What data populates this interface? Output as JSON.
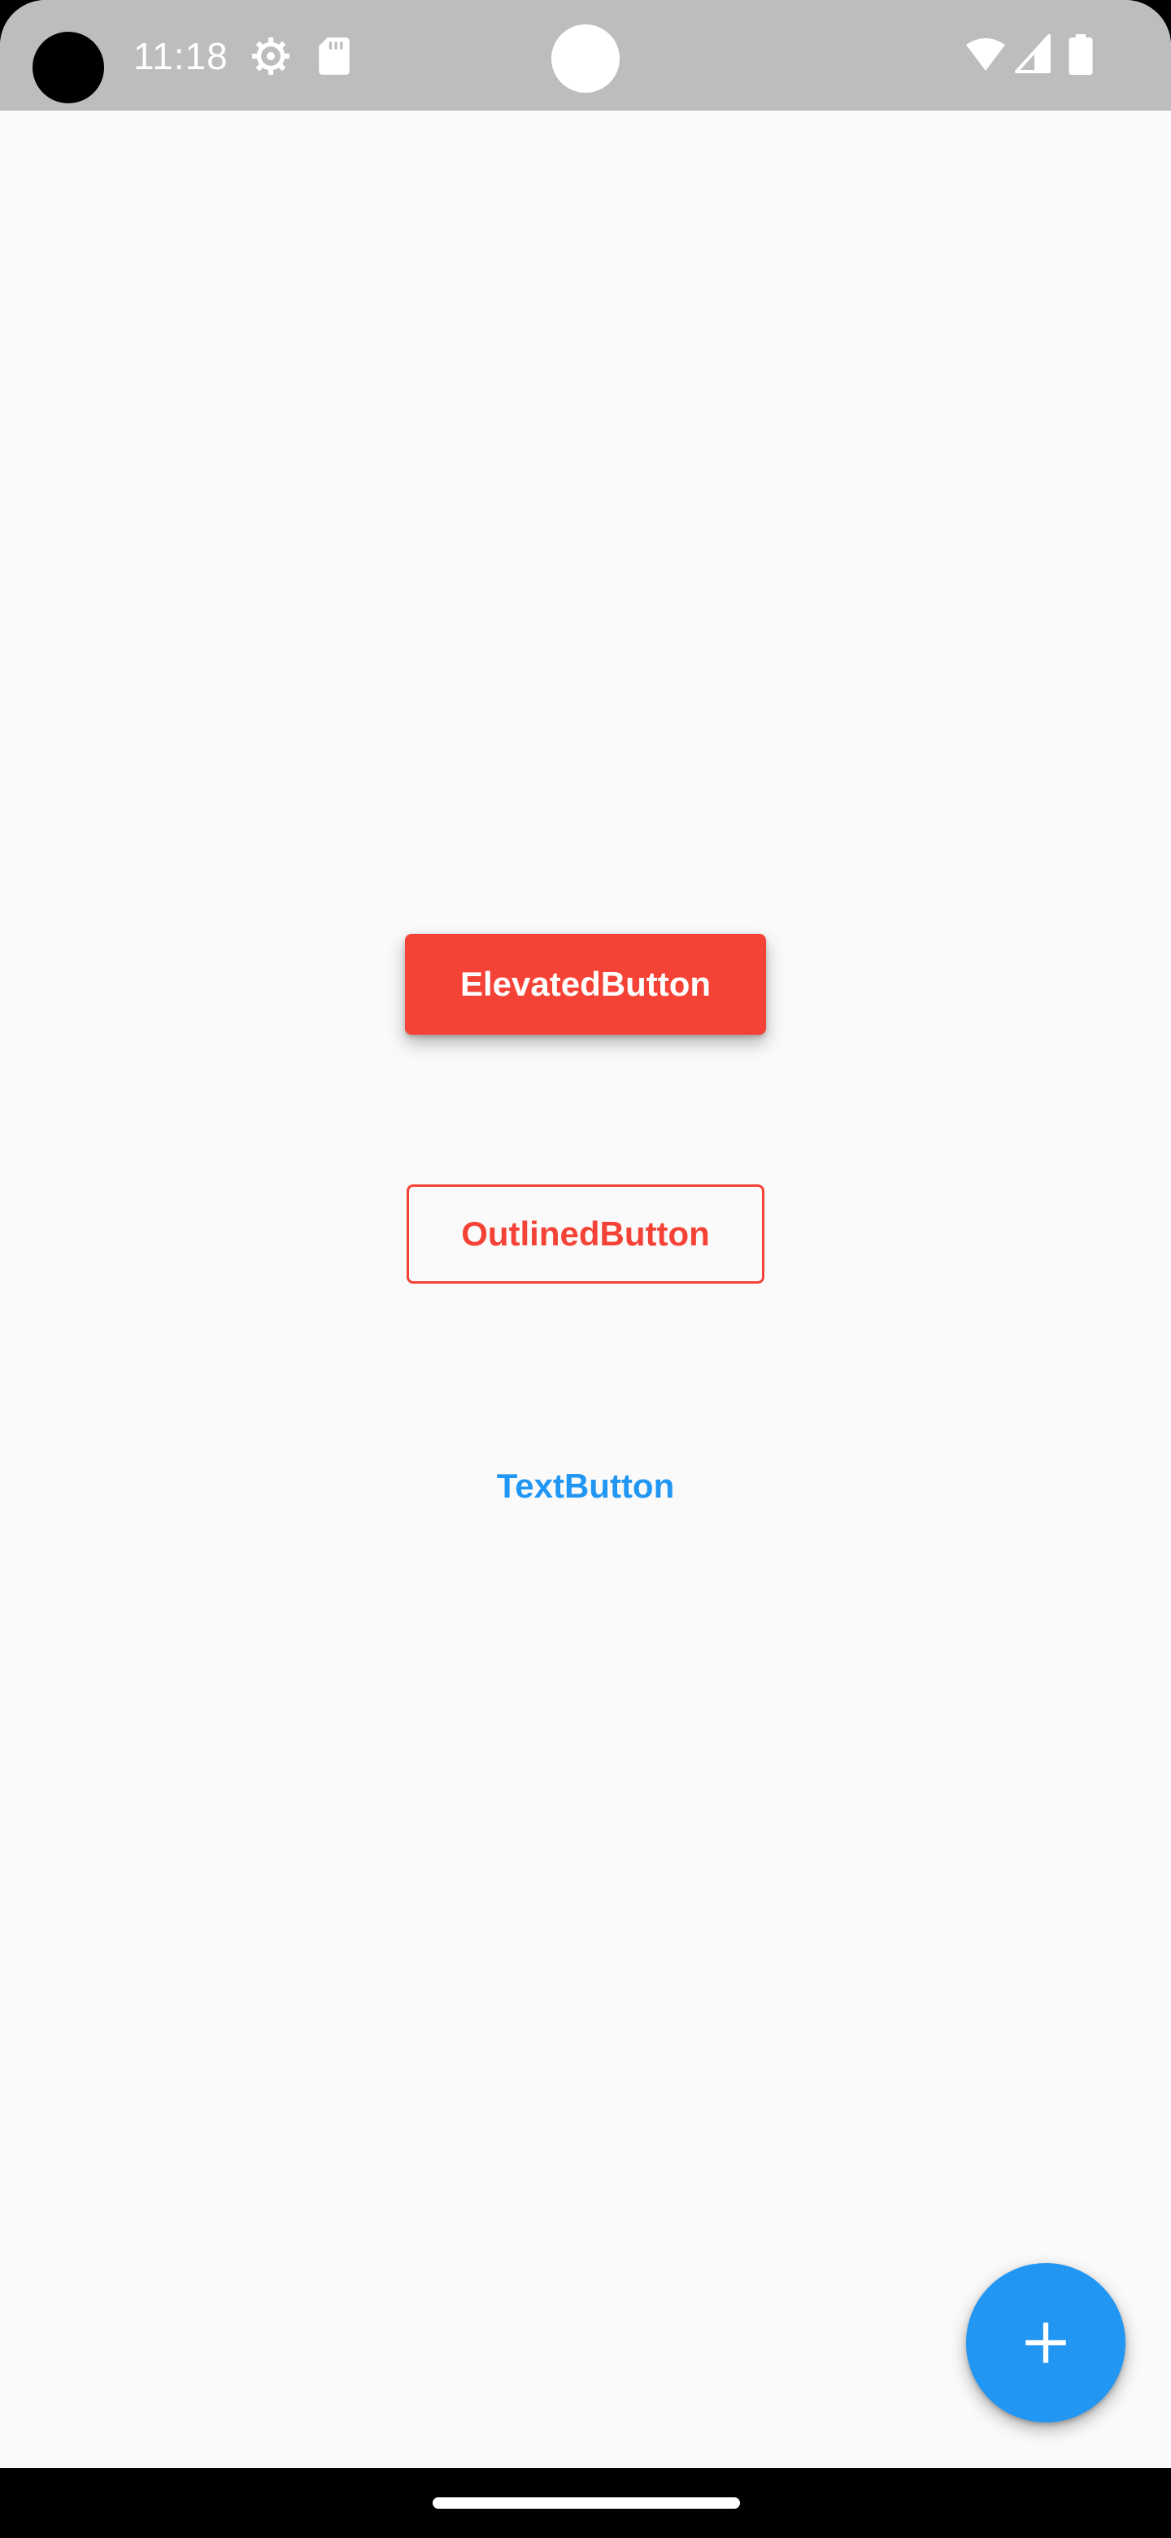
{
  "status_bar": {
    "time": "11:18",
    "icons": [
      "camera-cutout",
      "gear-icon",
      "sd-card-icon",
      "wifi-icon",
      "cell-signal-icon",
      "battery-icon"
    ]
  },
  "buttons": {
    "elevated_label": "ElevatedButton",
    "outlined_label": "OutlinedButton",
    "text_label": "TextButton"
  },
  "fab": {
    "icon": "plus-icon"
  },
  "colors": {
    "status_bar_bg": "#BDBDBD",
    "background": "#FAFAFA",
    "red_accent": "#F44336",
    "blue_accent": "#2196F3",
    "nav_bar_bg": "#000000"
  }
}
